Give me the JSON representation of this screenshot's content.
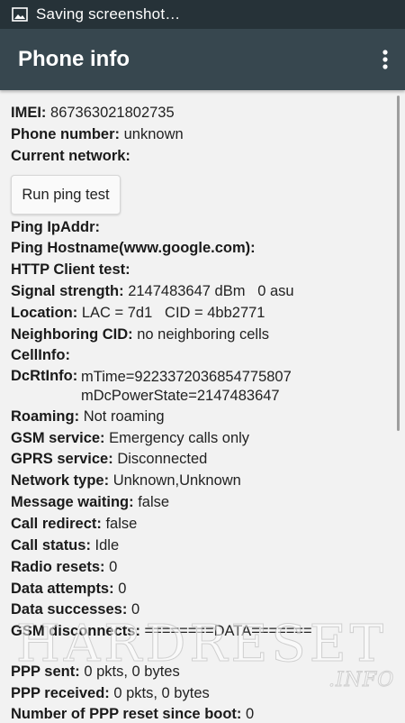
{
  "status_bar": {
    "notification": "Saving screenshot…",
    "icon": "image-icon"
  },
  "app_bar": {
    "title": "Phone info",
    "menu_icon": "overflow-menu-icon"
  },
  "ping_button": "Run ping test",
  "rows": {
    "imei": {
      "label": "IMEI:",
      "value": "867363021802735"
    },
    "phone_number": {
      "label": "Phone number:",
      "value": "unknown"
    },
    "current_network": {
      "label": "Current network:",
      "value": ""
    },
    "ping_ipaddr": {
      "label": "Ping IpAddr:",
      "value": ""
    },
    "ping_hostname": {
      "label": "Ping Hostname(www.google.com):",
      "value": ""
    },
    "http_client": {
      "label": "HTTP Client test:",
      "value": ""
    },
    "signal_strength": {
      "label": "Signal strength:",
      "value": "2147483647 dBm   0 asu"
    },
    "location": {
      "label": "Location:",
      "value": "LAC = 7d1   CID = 4bb2771"
    },
    "neighboring_cid": {
      "label": "Neighboring CID:",
      "value": "no neighboring cells"
    },
    "cellinfo": {
      "label": "CellInfo:",
      "value": ""
    },
    "dcrtinfo": {
      "label": "DcRtInfo:",
      "line1": "mTime=9223372036854775807",
      "line2": "mDcPowerState=2147483647"
    },
    "roaming": {
      "label": "Roaming:",
      "value": "Not roaming"
    },
    "gsm_service": {
      "label": "GSM service:",
      "value": "Emergency calls only"
    },
    "gprs_service": {
      "label": "GPRS service:",
      "value": "Disconnected"
    },
    "network_type": {
      "label": "Network type:",
      "value": "Unknown,Unknown"
    },
    "message_waiting": {
      "label": "Message waiting:",
      "value": "false"
    },
    "call_redirect": {
      "label": "Call redirect:",
      "value": "false"
    },
    "call_status": {
      "label": "Call status:",
      "value": "Idle"
    },
    "radio_resets": {
      "label": "Radio resets:",
      "value": "0"
    },
    "data_attempts": {
      "label": "Data attempts:",
      "value": "0"
    },
    "data_successes": {
      "label": "Data successes:",
      "value": "0"
    },
    "gsm_disconnects": {
      "label": "GSM disconnects:",
      "value": "========DATA======="
    },
    "ppp_sent": {
      "label": "PPP sent:",
      "value": "0 pkts, 0 bytes"
    },
    "ppp_received": {
      "label": "PPP received:",
      "value": "0 pkts, 0 bytes"
    },
    "ppp_resets": {
      "label": "Number of PPP reset since boot:",
      "value": "0"
    }
  },
  "watermark": {
    "main": "HARDRESET",
    "sub": ".INFO"
  },
  "colors": {
    "status_bar": "#263238",
    "app_bar": "#37474f",
    "background": "#f2f2f2"
  }
}
